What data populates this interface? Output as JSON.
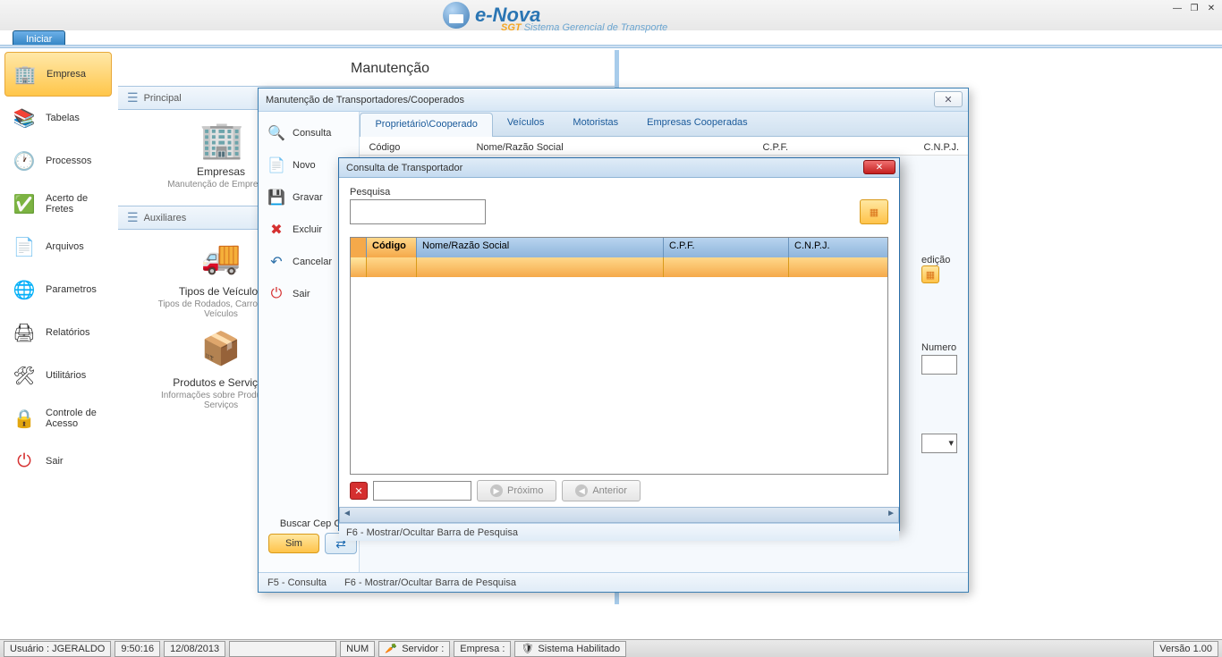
{
  "app": {
    "start": "Iniciar",
    "brand": "e-Nova",
    "brand_sub_sgt": "SGT",
    "brand_sub_rest": "Sistema Gerencial de Transporte"
  },
  "sidebar": {
    "items": [
      {
        "label": "Empresa",
        "icon": "company"
      },
      {
        "label": "Tabelas",
        "icon": "books"
      },
      {
        "label": "Processos",
        "icon": "clock"
      },
      {
        "label": "Acerto de Fretes",
        "icon": "check"
      },
      {
        "label": "Arquivos",
        "icon": "file"
      },
      {
        "label": "Parametros",
        "icon": "globe"
      },
      {
        "label": "Relatórios",
        "icon": "printer"
      },
      {
        "label": "Utilitários",
        "icon": "tool"
      },
      {
        "label": "Controle de Acesso",
        "icon": "lock"
      },
      {
        "label": "Sair",
        "icon": "power"
      }
    ]
  },
  "content": {
    "title": "Manutenção",
    "group_principal": "Principal",
    "group_aux": "Auxiliares",
    "empresas": {
      "label": "Empresas",
      "desc": "Manutenção de Empresas."
    },
    "tipos": {
      "label": "Tipos de Veículos",
      "desc": "Tipos de Rodados, Carrocerias, Veículos"
    },
    "prodserv": {
      "label": "Produtos e Serviços",
      "desc": "Informações sobre Produtos e Serviços"
    }
  },
  "dlg1": {
    "title": "Manutenção de Transportadores/Cooperados",
    "side": [
      {
        "label": "Consulta",
        "icon": "search"
      },
      {
        "label": "Novo",
        "icon": "new"
      },
      {
        "label": "Gravar",
        "icon": "save"
      },
      {
        "label": "Excluir",
        "icon": "del"
      },
      {
        "label": "Cancelar",
        "icon": "undo"
      },
      {
        "label": "Sair",
        "icon": "exit"
      }
    ],
    "tabs": [
      "Proprietário\\Cooperado",
      "Veículos",
      "Motoristas",
      "Empresas Cooperadas"
    ],
    "cols": {
      "codigo": "Código",
      "nome": "Nome/Razão Social",
      "cpf": "C.P.F.",
      "cnpj": "C.N.P.J."
    },
    "right": {
      "expedicao": "edição",
      "numero": "Numero"
    },
    "footer": {
      "f5": "F5 - Consulta",
      "f6": "F6 - Mostrar/Ocultar Barra de Pesquisa"
    }
  },
  "cep": {
    "title": "Buscar Cep Online",
    "sim": "Sim"
  },
  "dlg2": {
    "title": "Consulta de Transportador",
    "pesquisa": "Pesquisa",
    "cols": {
      "codigo": "Código",
      "nome": "Nome/Razão Social",
      "cpf": "C.P.F.",
      "cnpj": "C.N.P.J."
    },
    "proximo": "Próximo",
    "anterior": "Anterior",
    "footer": "F6 - Mostrar/Ocultar Barra de Pesquisa"
  },
  "status": {
    "user": "Usuário : JGERALDO",
    "time": "9:50:16",
    "date": "12/08/2013",
    "num": "NUM",
    "servidor": "Servidor :",
    "empresa": "Empresa :",
    "sys": "Sistema Habilitado",
    "version": "Versão 1.00"
  }
}
